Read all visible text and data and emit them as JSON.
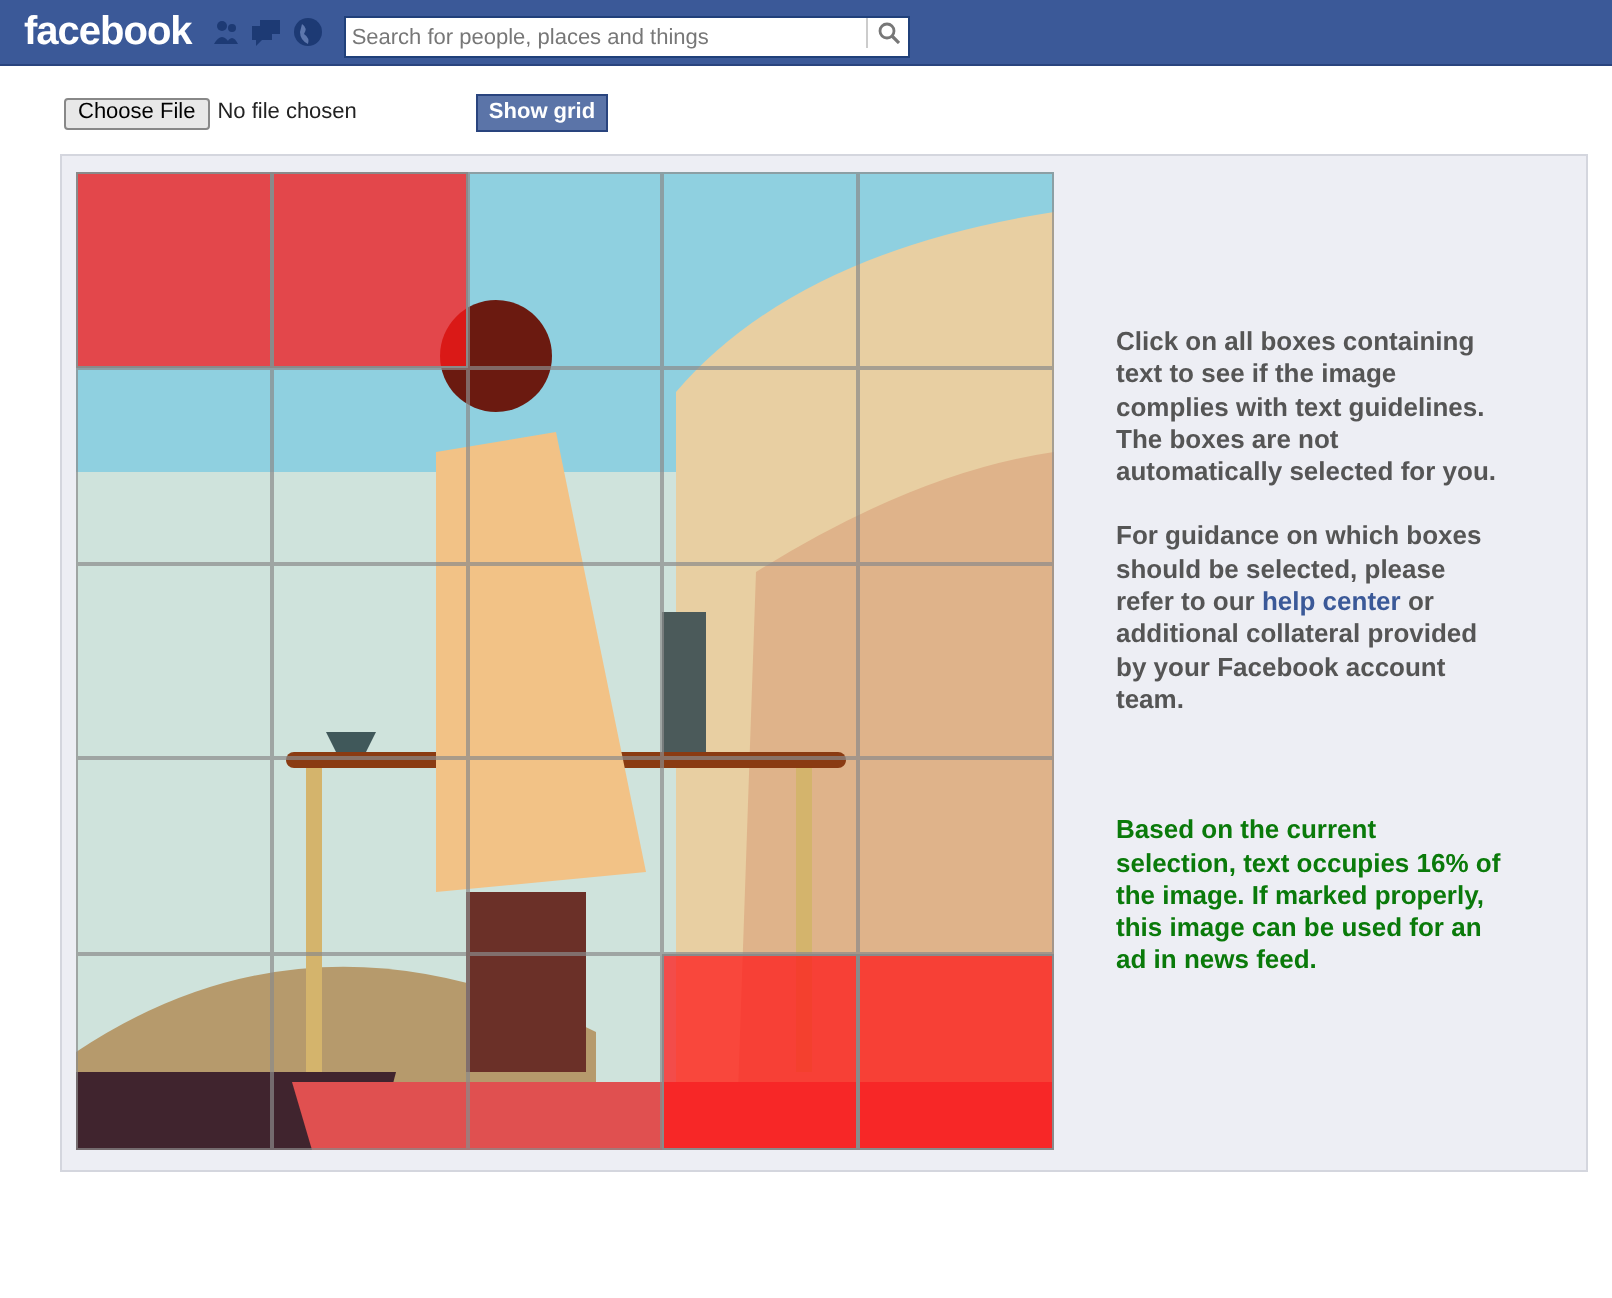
{
  "header": {
    "logo": "facebook",
    "search": {
      "placeholder": "Search for people, places and things"
    }
  },
  "upload": {
    "button": "Choose File",
    "status": "No file chosen"
  },
  "show_grid_button": "Show grid",
  "grid": {
    "rows": [
      [
        {
          "selected": true
        },
        {
          "selected": true
        },
        {
          "selected": false
        },
        {
          "selected": false
        },
        {
          "selected": false
        }
      ],
      [
        {
          "selected": false
        },
        {
          "selected": false
        },
        {
          "selected": false
        },
        {
          "selected": false
        },
        {
          "selected": false
        }
      ],
      [
        {
          "selected": false
        },
        {
          "selected": false
        },
        {
          "selected": false
        },
        {
          "selected": false
        },
        {
          "selected": false
        }
      ],
      [
        {
          "selected": false
        },
        {
          "selected": false
        },
        {
          "selected": false
        },
        {
          "selected": false
        },
        {
          "selected": false
        }
      ],
      [
        {
          "selected": false
        },
        {
          "selected": false
        },
        {
          "selected": false
        },
        {
          "selected": true
        },
        {
          "selected": true
        }
      ]
    ]
  },
  "instructions": "Click on all boxes containing text to see if the image complies with text guidelines. The boxes are not automatically selected for you.",
  "guidance": {
    "before": "For guidance on which boxes should be selected, please refer to our",
    "link": "help center",
    "after": "or additional collateral provided by your Facebook account team."
  },
  "result": "Based on the current selection, text occupies 16% of the image. If marked properly, this image can be used for an ad in news feed."
}
